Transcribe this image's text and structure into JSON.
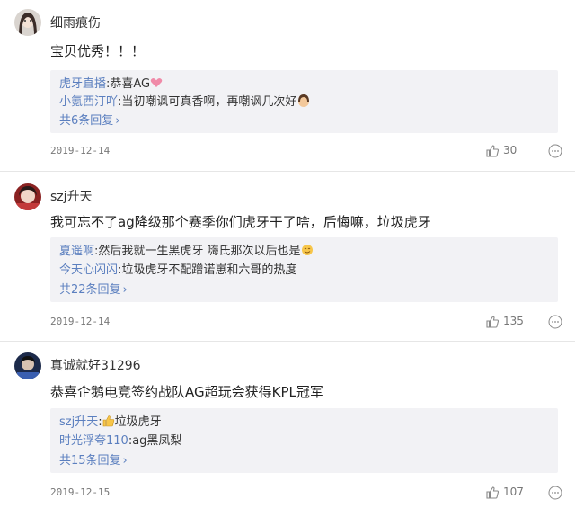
{
  "comments": [
    {
      "username": "细雨痕伤",
      "text": "宝贝优秀！！！",
      "replies": [
        {
          "user": "虎牙直播",
          "text": ":恭喜AG",
          "emoji": "heart-emoji"
        },
        {
          "user": "小氪西汀吖",
          "text": ":当初嘲讽可真香啊，再嘲讽几次好",
          "emoji": "face-emoji"
        }
      ],
      "more": "共6条回复",
      "date": "2019-12-14",
      "likes": "30"
    },
    {
      "username": "szj升天",
      "text": "我可忘不了ag降级那个赛季你们虎牙干了啥，后悔嘛，垃圾虎牙",
      "replies": [
        {
          "user": "夏遥啊",
          "text": ":然后我就一生黑虎牙 嗨氏那次以后也是",
          "emoji": "smile-emoji"
        },
        {
          "user": "今天心闪闪",
          "text": ":垃圾虎牙不配蹭诺崽和六哥的热度",
          "emoji": ""
        }
      ],
      "more": "共22条回复",
      "date": "2019-12-14",
      "likes": "135"
    },
    {
      "username": "真诚就好31296",
      "text": "恭喜企鹅电竞签约战队AG超玩会获得KPL冠军",
      "replies": [
        {
          "user": "szj升天",
          "text": ":垃圾虎牙",
          "emoji": "thumb-emoji",
          "emoji_first": true
        },
        {
          "user": "时光浮夸110",
          "text": ":ag黑凤梨",
          "emoji": ""
        }
      ],
      "more": "共15条回复",
      "date": "2019-12-15",
      "likes": "107"
    }
  ],
  "colors": {
    "link": "#5b7fbf",
    "reply_bg": "#f2f2f5",
    "divider": "#e6e6e6"
  }
}
